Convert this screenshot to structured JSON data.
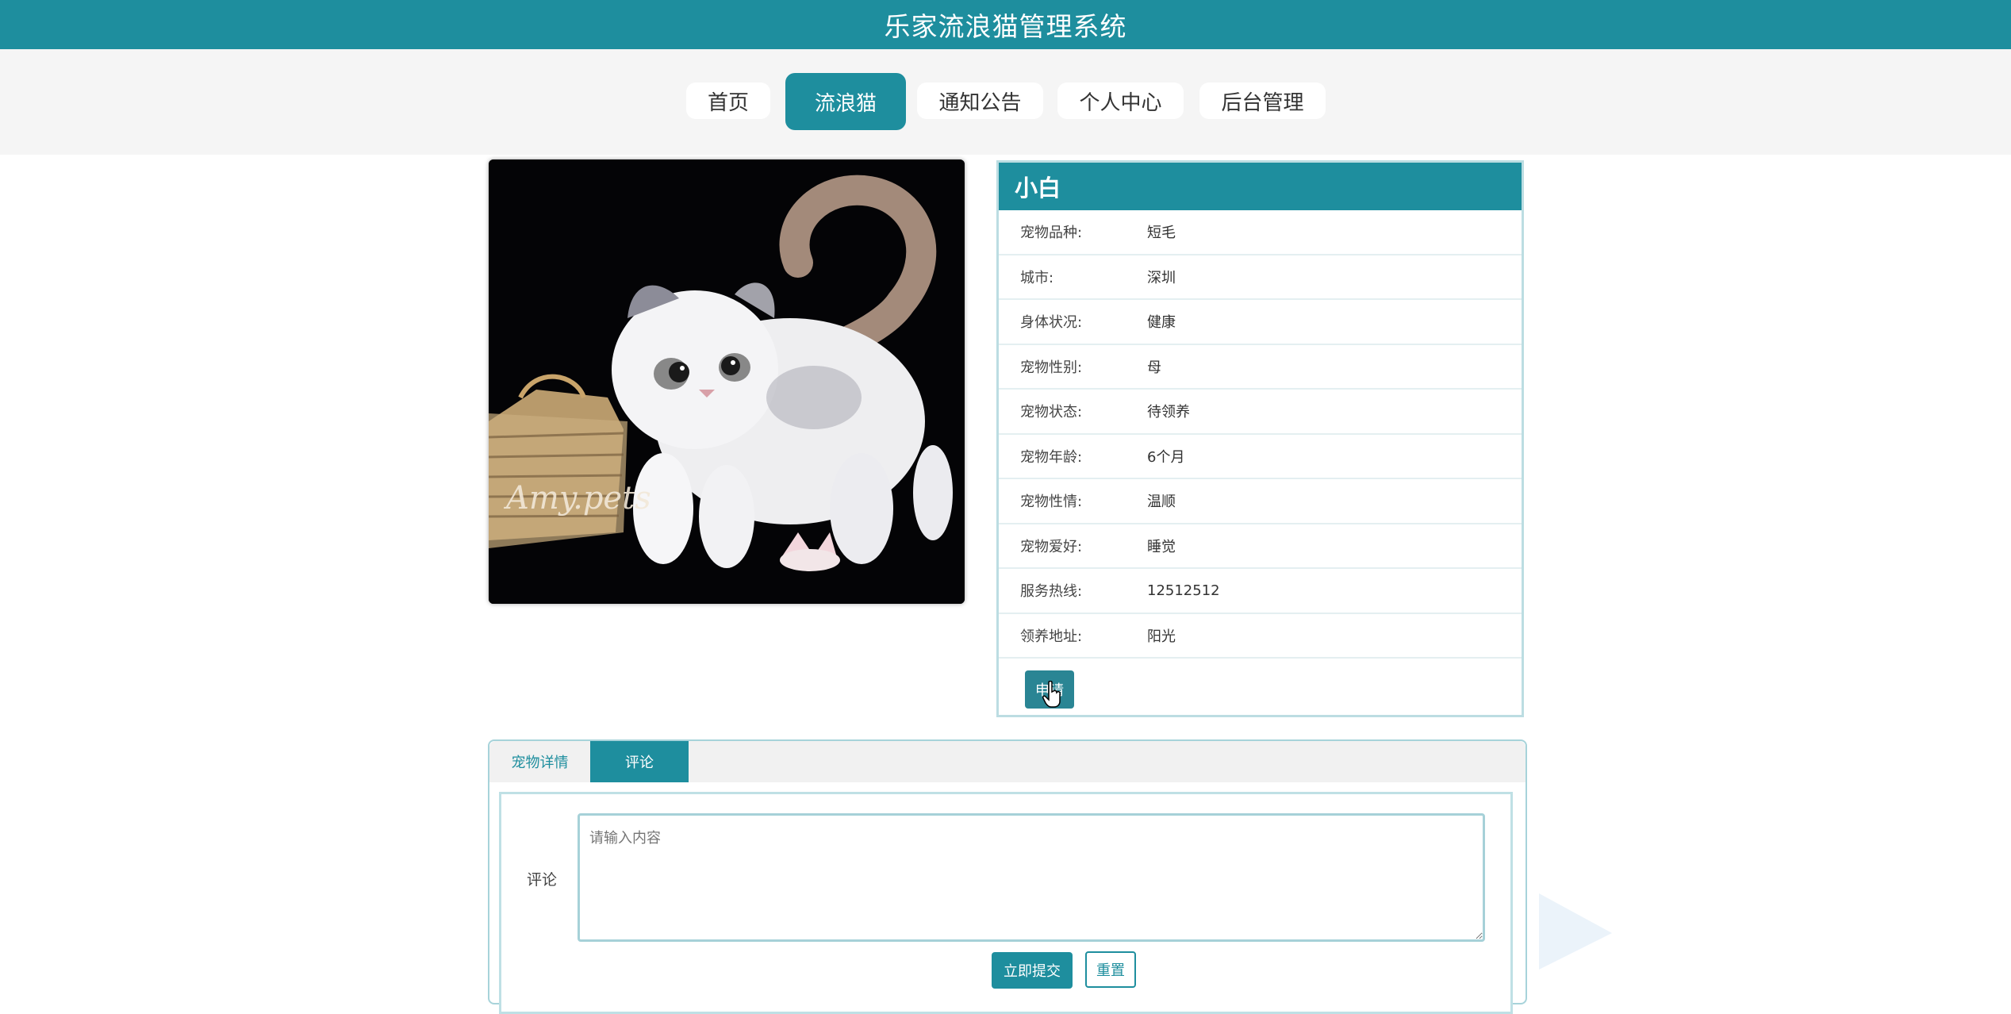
{
  "app": {
    "title": "乐家流浪猫管理系统"
  },
  "nav": {
    "items": [
      {
        "label": "首页"
      },
      {
        "label": "流浪猫",
        "active": true
      },
      {
        "label": "通知公告"
      },
      {
        "label": "个人中心"
      },
      {
        "label": "后台管理"
      }
    ]
  },
  "photo": {
    "watermark": "Amy.pets"
  },
  "pet": {
    "name": "小白",
    "fields": [
      {
        "label": "宠物品种:",
        "value": "短毛"
      },
      {
        "label": "城市:",
        "value": "深圳"
      },
      {
        "label": "身体状况:",
        "value": "健康"
      },
      {
        "label": "宠物性别:",
        "value": "母"
      },
      {
        "label": "宠物状态:",
        "value": "待领养"
      },
      {
        "label": "宠物年龄:",
        "value": "6个月"
      },
      {
        "label": "宠物性情:",
        "value": "温顺"
      },
      {
        "label": "宠物爱好:",
        "value": "睡觉"
      },
      {
        "label": "服务热线:",
        "value": "12512512"
      },
      {
        "label": "领养地址:",
        "value": "阳光"
      }
    ],
    "apply_label": "申请"
  },
  "tabs": [
    {
      "label": "宠物详情"
    },
    {
      "label": "评论",
      "active": true
    }
  ],
  "comment": {
    "label": "评论",
    "placeholder": "请输入内容",
    "submit_label": "立即提交",
    "reset_label": "重置"
  },
  "colors": {
    "primary": "#1e8e9e",
    "band": "#f5f5f5"
  }
}
